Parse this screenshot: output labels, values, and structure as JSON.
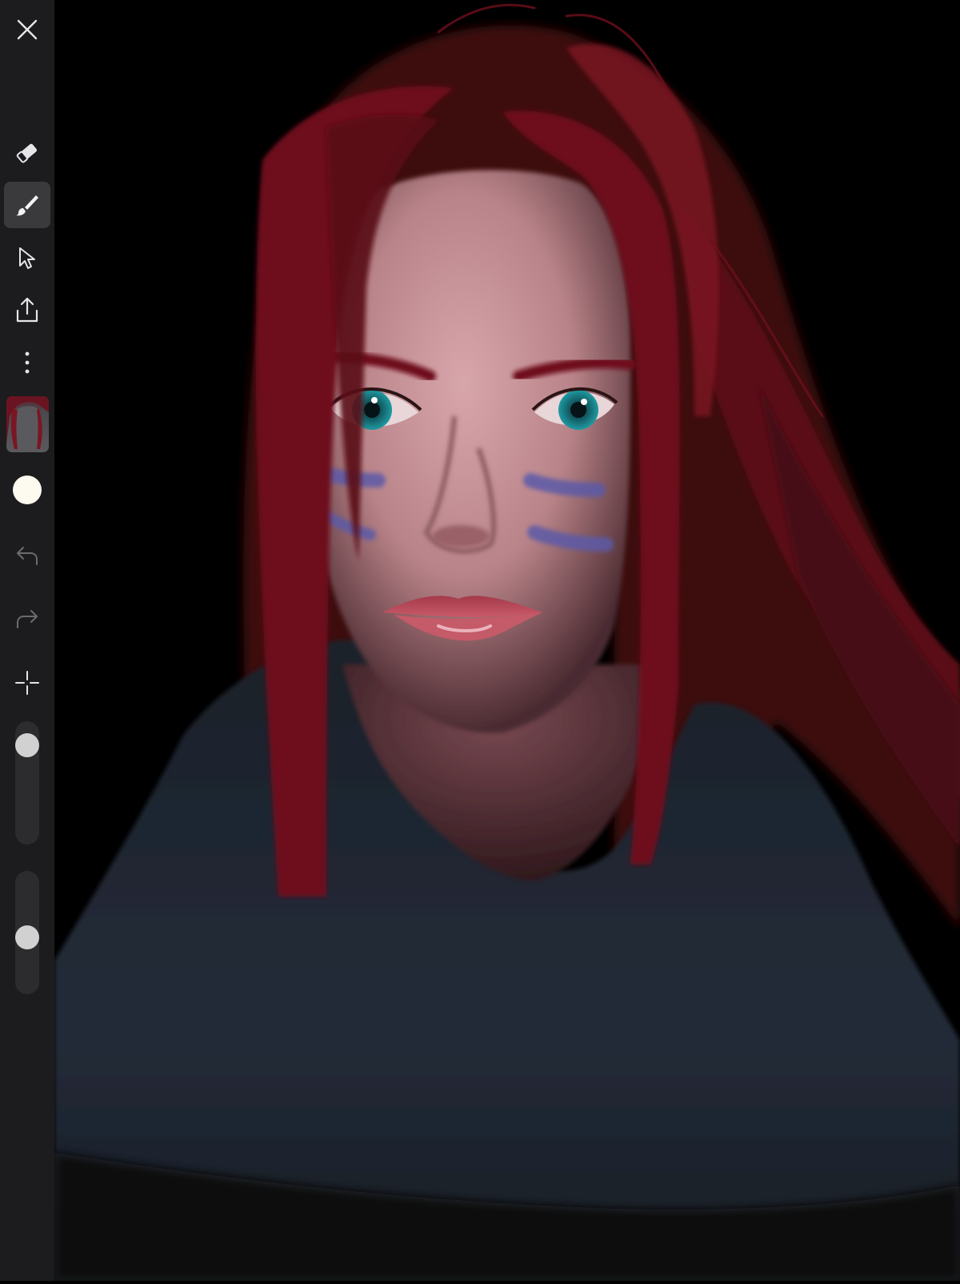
{
  "toolbar": {
    "tools": [
      {
        "name": "close",
        "icon": "close-icon"
      },
      {
        "name": "eraser",
        "icon": "eraser-icon"
      },
      {
        "name": "brush",
        "icon": "brush-icon",
        "active": true
      },
      {
        "name": "select",
        "icon": "cursor-arrow-icon"
      },
      {
        "name": "export",
        "icon": "share-upload-icon"
      },
      {
        "name": "more",
        "icon": "more-vertical-icon"
      },
      {
        "name": "layers",
        "icon": "layer-thumbnail"
      },
      {
        "name": "color",
        "icon": "color-swatch"
      },
      {
        "name": "undo",
        "icon": "undo-icon",
        "enabled": false
      },
      {
        "name": "redo",
        "icon": "redo-icon",
        "enabled": false
      },
      {
        "name": "eyedropper",
        "icon": "crosshair-icon"
      }
    ],
    "current_color": "#fdfbf0",
    "brush_size_level": 0.12,
    "brush_opacity_level": 0.55
  },
  "colors": {
    "sidebar_bg": "#1c1c1e",
    "active_tool_bg": "#3a3a3c",
    "icon": "#e5e5ea",
    "icon_disabled": "#6b6b70",
    "canvas_bg": "#000000",
    "hair": "#6e0f1c",
    "skin": "#c9999f",
    "sweater": "#1d2430",
    "paint_stripes": "#5a5aa8",
    "iris": "#1a8a92",
    "lips": "#b94a5a"
  },
  "canvas": {
    "artwork": "digital-painting-portrait"
  }
}
